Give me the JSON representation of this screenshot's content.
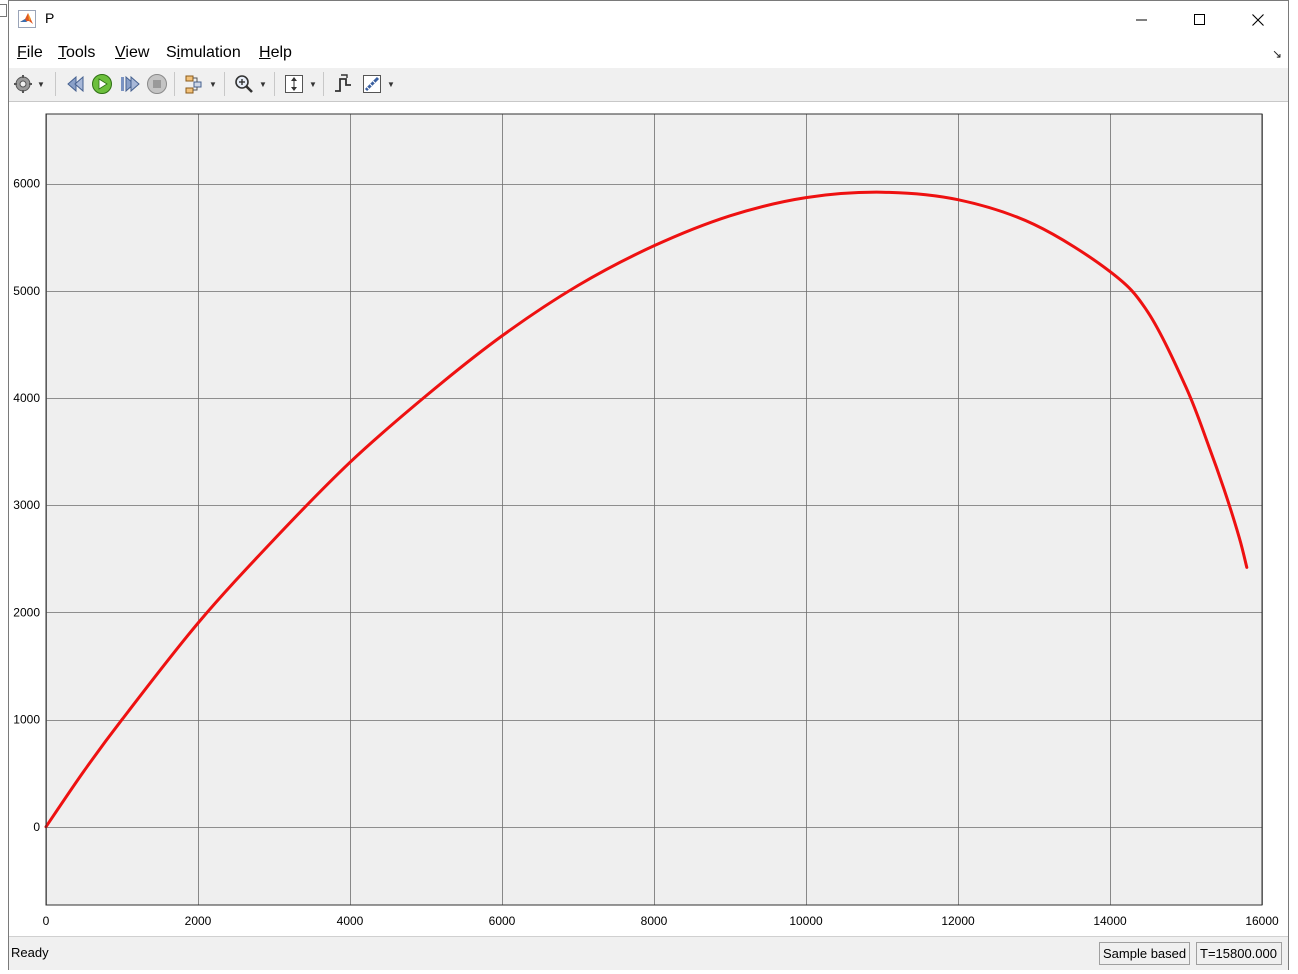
{
  "window": {
    "title": "P",
    "controls": {
      "minimize": "minimize",
      "maximize": "maximize",
      "close": "close"
    }
  },
  "menu": [
    {
      "key": "F",
      "rest": "ile"
    },
    {
      "key": "T",
      "rest": "ools"
    },
    {
      "key": "V",
      "rest": "iew"
    },
    {
      "pre": "S",
      "key": "i",
      "rest": "mulation"
    },
    {
      "key": "H",
      "rest": "elp"
    }
  ],
  "toolbar": {
    "items": [
      "gear-icon",
      "step-back-icon",
      "run-icon",
      "step-forward-icon",
      "stop-icon",
      "highlight-icon",
      "zoom-icon",
      "autoscale-icon",
      "triggers-icon",
      "cursor-measure-icon"
    ]
  },
  "status": {
    "left": "Ready",
    "mode": "Sample based",
    "time": "T=15800.000"
  },
  "chart_data": {
    "type": "line",
    "title": "",
    "xlabel": "",
    "ylabel": "",
    "xlim": [
      0,
      16000
    ],
    "ylim": [
      -730,
      6650
    ],
    "xticks": [
      0,
      2000,
      4000,
      6000,
      8000,
      10000,
      12000,
      14000,
      16000
    ],
    "yticks": [
      0,
      1000,
      2000,
      3000,
      4000,
      5000,
      6000
    ],
    "grid": true,
    "background": "#efefef",
    "grid_color": "#6e6e6e",
    "series": [
      {
        "color": "#ee1111",
        "x": [
          0,
          500,
          1000,
          2000,
          3000,
          4000,
          5000,
          6000,
          7000,
          8000,
          9000,
          10000,
          11000,
          12000,
          13000,
          14000,
          14500,
          15000,
          15300,
          15500,
          15700,
          15800
        ],
        "y": [
          0,
          520,
          1000,
          1900,
          2680,
          3400,
          4020,
          4580,
          5050,
          5420,
          5700,
          5870,
          5920,
          5850,
          5620,
          5180,
          4800,
          4100,
          3550,
          3150,
          2700,
          2420
        ]
      }
    ]
  }
}
